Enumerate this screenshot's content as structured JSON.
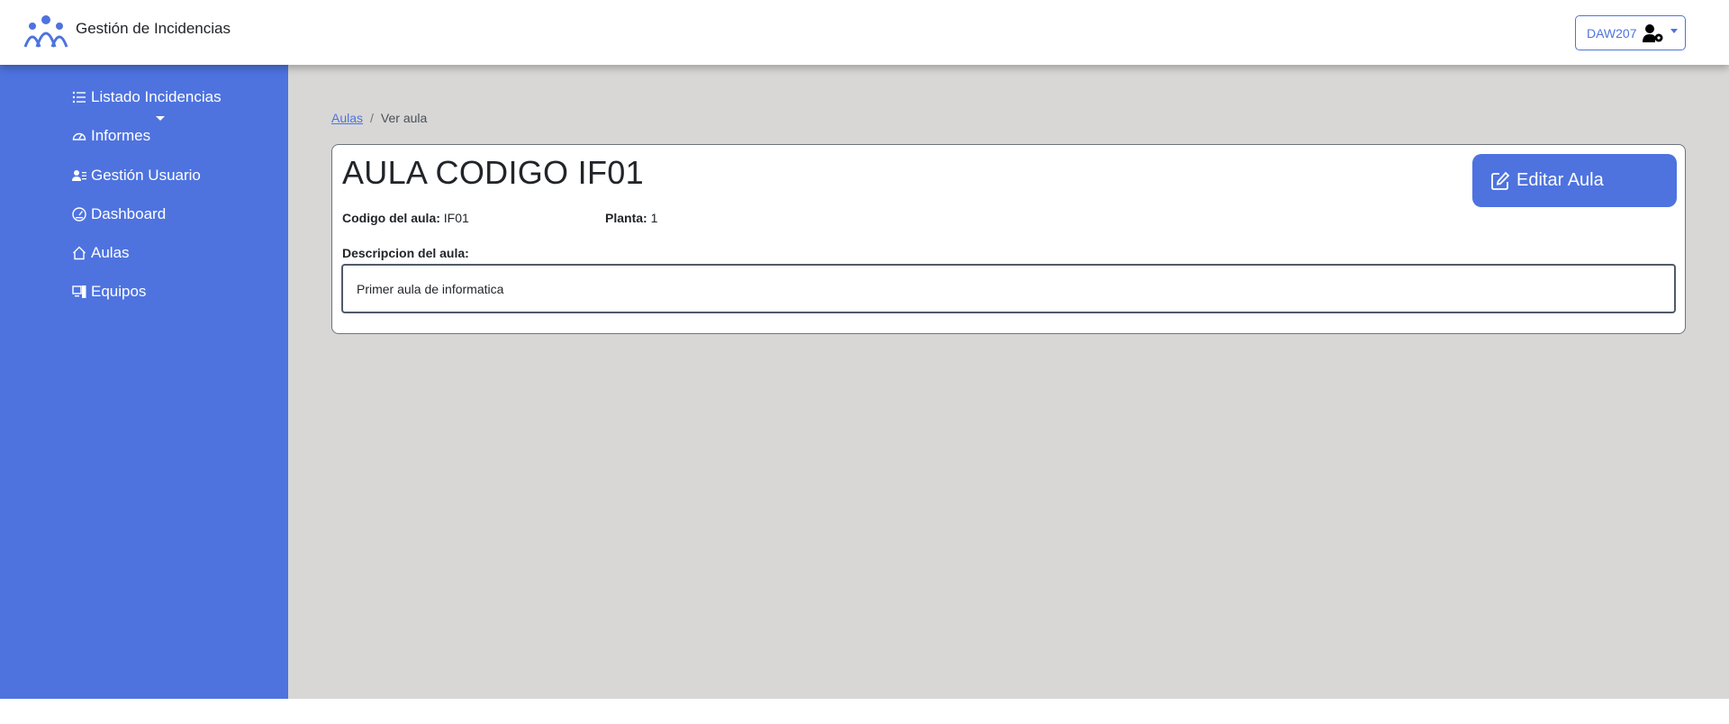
{
  "header": {
    "app_title": "Gestión de Incidencias",
    "user_label": "DAW207"
  },
  "sidebar": {
    "items": [
      {
        "label": "Listado Incidencias",
        "icon": "list-icon"
      },
      {
        "label": "Informes",
        "icon": "speedometer-icon"
      },
      {
        "label": "Gestión Usuario",
        "icon": "user-list-icon"
      },
      {
        "label": "Dashboard",
        "icon": "dashboard-icon"
      },
      {
        "label": "Aulas",
        "icon": "house-icon"
      },
      {
        "label": "Equipos",
        "icon": "pc-icon"
      }
    ]
  },
  "breadcrumb": {
    "parent": "Aulas",
    "separator": "/",
    "current": "Ver aula"
  },
  "aula": {
    "title": "AULA CODIGO IF01",
    "edit_label": "Editar Aula",
    "codigo_label": "Codigo del aula:",
    "codigo_value": "IF01",
    "planta_label": "Planta:",
    "planta_value": "1",
    "descripcion_label": "Descripcion del aula:",
    "descripcion_value": "Primer aula de informatica"
  },
  "colors": {
    "accent": "#4e73df",
    "background": "#d8d7d6"
  }
}
